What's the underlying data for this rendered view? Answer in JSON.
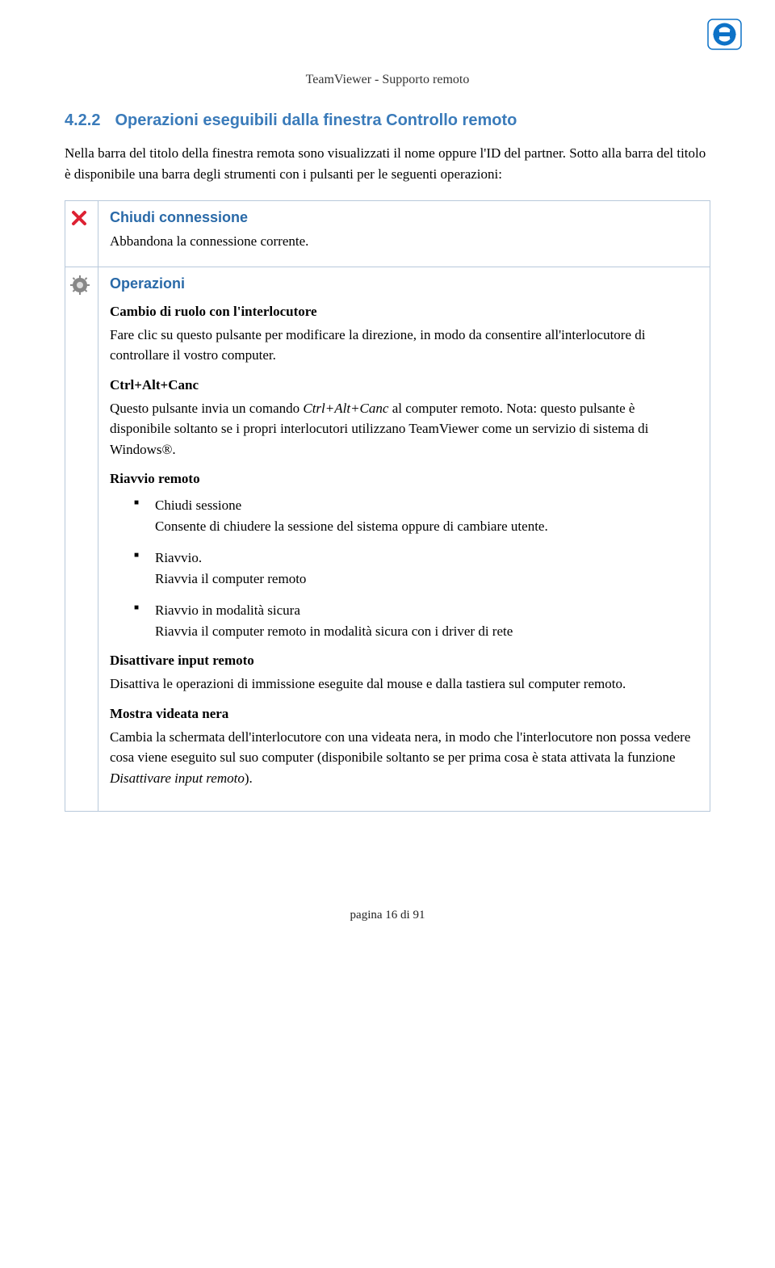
{
  "header": {
    "title": "TeamViewer - Supporto remoto"
  },
  "section": {
    "number": "4.2.2",
    "title": "Operazioni eseguibili dalla finestra Controllo remoto",
    "intro": "Nella barra del titolo della finestra remota sono visualizzati il nome oppure l'ID del partner. Sotto alla barra del titolo è disponibile una barra degli strumenti con i pulsanti per le seguenti operazioni:"
  },
  "rows": {
    "close": {
      "title": "Chiudi connessione",
      "desc": "Abbandona la connessione corrente."
    },
    "ops": {
      "title": "Operazioni",
      "switch_h": "Cambio di ruolo con l'interlocutore",
      "switch_p": "Fare clic su questo pulsante per modificare la direzione, in modo da consentire all'interlocutore di controllare il vostro computer.",
      "cad_h": "Ctrl+Alt+Canc",
      "cad_p1": "Questo pulsante invia un comando ",
      "cad_em": "Ctrl+Alt+Canc",
      "cad_p2": " al computer remoto. Nota: questo pulsante è disponibile soltanto se i propri interlocutori utilizzano TeamViewer come un servizio di sistema di Windows®.",
      "reboot_h": "Riavvio remoto",
      "bullets": {
        "b1_t": "Chiudi sessione",
        "b1_d": "Consente di chiudere la sessione del sistema oppure di cambiare utente.",
        "b2_t": "Riavvio.",
        "b2_d": "Riavvia il computer remoto",
        "b3_t": "Riavvio in modalità sicura",
        "b3_d": "Riavvia il computer remoto in modalità sicura con i driver di rete"
      },
      "disable_h": "Disattivare input remoto",
      "disable_p": "Disattiva le operazioni di immissione eseguite dal mouse e dalla tastiera sul computer remoto.",
      "black_h": "Mostra videata nera",
      "black_p1": "Cambia la schermata dell'interlocutore con una videata nera, in modo che l'interlocutore non possa vedere cosa viene eseguito sul suo computer (disponibile soltanto se per prima cosa è stata attivata la funzione ",
      "black_em": "Disattivare input remoto",
      "black_p2": ")."
    }
  },
  "footer": {
    "text": "pagina 16 di 91"
  }
}
